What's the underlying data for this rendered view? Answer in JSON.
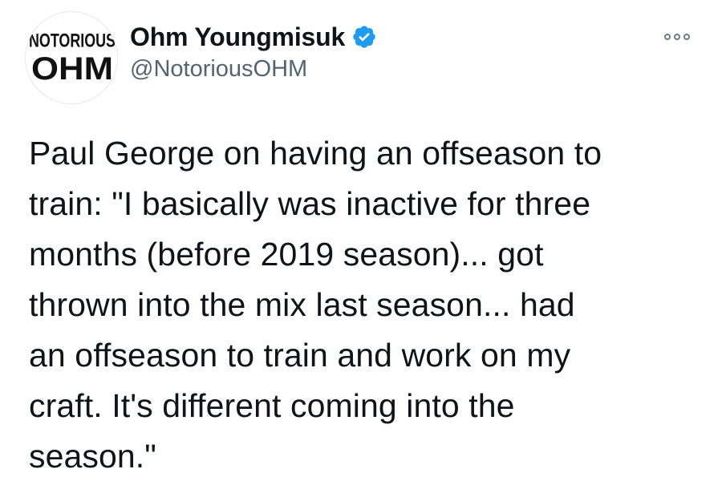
{
  "author": {
    "display_name": "Ohm Youngmisuk",
    "handle": "@NotoriousOHM",
    "verified": true,
    "avatar_text_top": "NOTORIOUS",
    "avatar_text_bottom": "OHM"
  },
  "menu": {
    "icon": "more-options-icon"
  },
  "tweet": {
    "text": "Paul George on having an offseason to\ntrain: \"I basically was inactive for three\nmonths (before 2019 season)... got\nthrown into the mix last season... had\nan offseason to train and work on my\ncraft. It's different coming into the\nseason.\""
  },
  "colors": {
    "verified_badge": "#1d9bf0",
    "handle": "#536471",
    "text": "#0f1419"
  }
}
